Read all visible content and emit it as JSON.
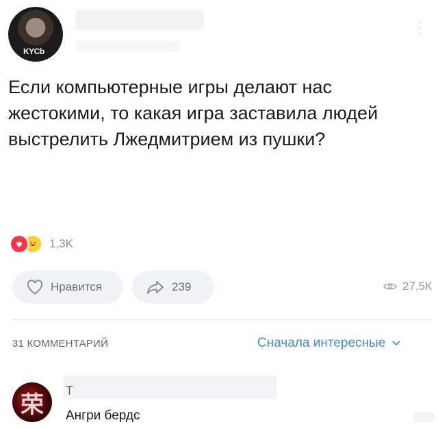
{
  "header": {
    "avatar_tag": "KYCb"
  },
  "post": {
    "text": "Если компьютерные игры делают нас жестокими, то какая игра заставила людей выстрелить Лжедмитрием из пушки?"
  },
  "reactions": {
    "count": "1,3K",
    "icons": [
      "heart-icon",
      "laughing-emoji-icon"
    ]
  },
  "actions": {
    "like_label": "Нравится",
    "share_count": "239",
    "views": "27,5К"
  },
  "comments": {
    "count_label": "31 КОММЕНТАРИЙ",
    "sort_label": "Сначала интересные",
    "items": [
      {
        "initial": "Т",
        "text": "Ангри бердс",
        "avatar_glyph": "荣"
      }
    ]
  },
  "colors": {
    "accent": "#4a89c8",
    "reaction_heart": "#ff3347",
    "reaction_laugh": "#ffcd3a",
    "button_bg": "#f1f2f5"
  }
}
